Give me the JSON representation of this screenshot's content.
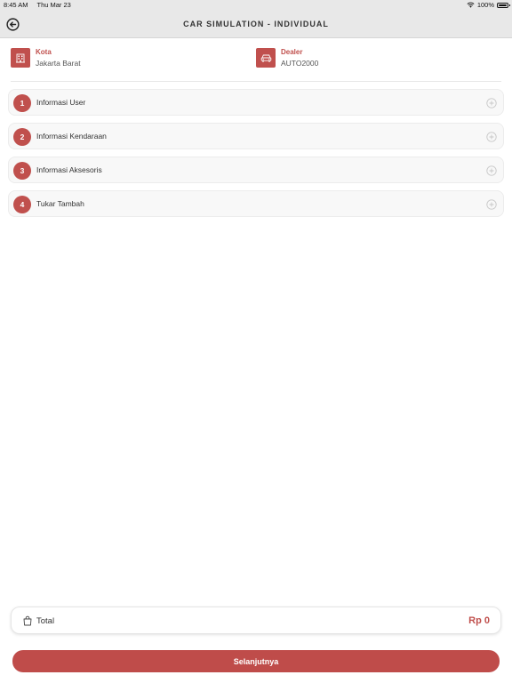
{
  "status_bar": {
    "time": "8:45 AM",
    "date": "Thu Mar 23",
    "battery": "100%",
    "icons": [
      "wifi-icon",
      "battery-icon"
    ]
  },
  "nav": {
    "title": "CAR SIMULATION - INDIVIDUAL",
    "back_icon": "back-arrow-icon"
  },
  "info": {
    "kota": {
      "label": "Kota",
      "value": "Jakarta Barat",
      "icon": "building-icon"
    },
    "dealer": {
      "label": "Dealer",
      "value": "AUTO2000",
      "icon": "car-icon"
    }
  },
  "sections": [
    {
      "number": "1",
      "label": "Informasi User"
    },
    {
      "number": "2",
      "label": "Informasi Kendaraan"
    },
    {
      "number": "3",
      "label": "Informasi Aksesoris"
    },
    {
      "number": "4",
      "label": "Tukar Tambah"
    }
  ],
  "total": {
    "label": "Total",
    "value": "Rp 0",
    "icon": "bag-icon"
  },
  "next_button": {
    "label": "Selanjutnya"
  },
  "colors": {
    "accent": "#c0504d",
    "background": "#ffffff",
    "bar": "#e8e8e8"
  }
}
